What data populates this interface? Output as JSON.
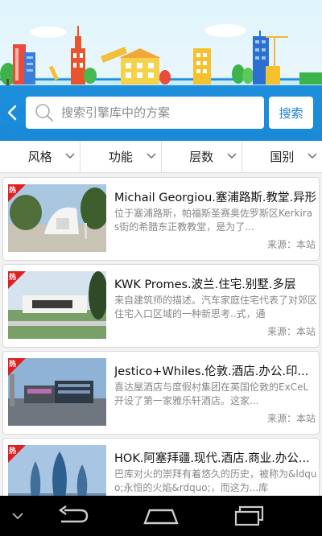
{
  "search": {
    "placeholder": "搜索引擎库中的方案",
    "button_label": "搜索"
  },
  "filters": [
    {
      "label": "风格"
    },
    {
      "label": "功能"
    },
    {
      "label": "层数"
    },
    {
      "label": "国别"
    }
  ],
  "items": [
    {
      "badge": "热",
      "title": "Michail Georgiou.塞浦路斯.教堂.异形",
      "description": "位于塞浦路斯，帕福斯圣赛奥佐罗斯区Kerkiras街的希腊东正教教堂，是为了...",
      "source": "来源：本站"
    },
    {
      "badge": "热",
      "title": "KWK Promes.波兰.住宅.别墅.多层",
      "description": "来自建筑师的描述。汽车家庭住宅代表了对郊区住宅入口区域的一种新思考..式，通",
      "source": "来源：本站"
    },
    {
      "badge": "热",
      "title": "Jestico+Whiles.伦敦.酒店.办公.印...",
      "description": "喜达屋酒店与度假村集团在英国伦敦的ExCeL开设了第一家雅乐轩酒店。这家...",
      "source": "来源：本站"
    },
    {
      "badge": "热",
      "title": "HOK.阿塞拜疆.现代.酒店.商业.办公...",
      "description": "巴库对火的崇拜有着悠久的历史，被称为&ldquo;永恒的火焰&rdquo;，而这为...库",
      "source": ""
    }
  ],
  "colors": {
    "accent": "#1a8ad8",
    "badge": "#e02020",
    "nav_bg": "#000000"
  }
}
